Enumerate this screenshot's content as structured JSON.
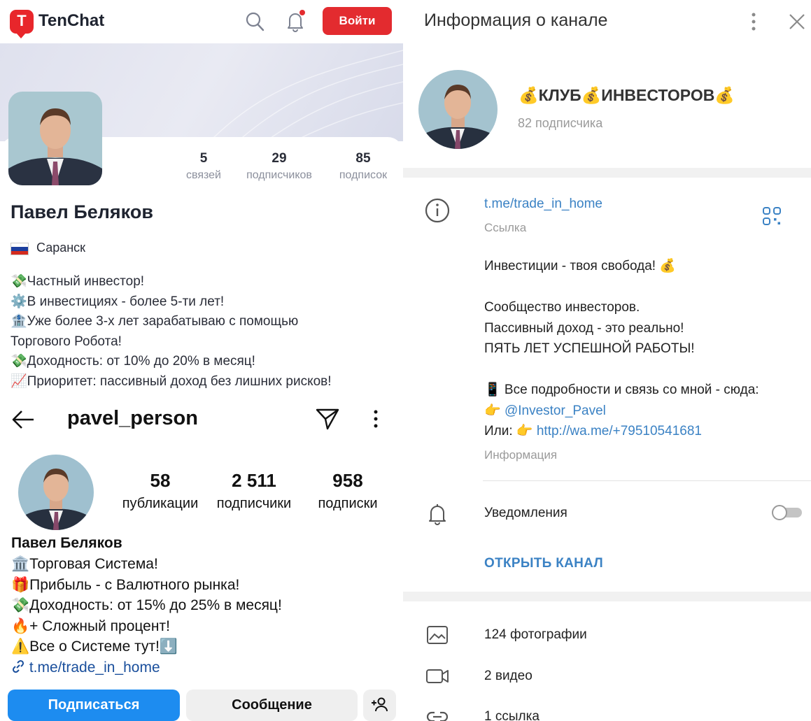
{
  "tenchat": {
    "logo_letter": "T",
    "logo_text": "TenChat",
    "login_label": "Войти",
    "stats": [
      {
        "num": "5",
        "label": "связей"
      },
      {
        "num": "29",
        "label": "подписчиков"
      },
      {
        "num": "85",
        "label": "подписок"
      }
    ],
    "name": "Павел Беляков",
    "city": "Саранск",
    "bio": [
      "💸Частный инвестор!",
      "⚙️В инвестициях - более 5-ти лет!",
      "🏦Уже более 3-х лет зарабатываю с помощью",
      "Торгового Робота!",
      "💸Доходность: от 10% до 20% в месяц!",
      "📈Приоритет: пассивный доход без лишних рисков!"
    ],
    "icons": {
      "search": "search-icon",
      "bell": "bell-icon",
      "accent": "#e32b2f"
    }
  },
  "instagram": {
    "username": "pavel_person",
    "stats": [
      {
        "num": "58",
        "label": "публикации"
      },
      {
        "num": "2 511",
        "label": "подписчики"
      },
      {
        "num": "958",
        "label": "подписки"
      }
    ],
    "name": "Павел Беляков",
    "bio": [
      "🏛️Торговая Система!",
      "🎁Прибыль - с Валютного рынка!",
      "💸Доходность: от 15% до 25% в месяц!",
      "🔥+ Сложный процент!",
      "⚠️Все о Системе тут!⬇️"
    ],
    "link": "t.me/trade_in_home",
    "follow_label": "Подписаться",
    "message_label": "Сообщение",
    "accent": "#1d8cf0"
  },
  "telegram": {
    "header_title": "Информация о канале",
    "channel_name": "💰КЛУБ💰ИНВЕСТОРОВ💰",
    "subscribers": "82 подписчика",
    "link": "t.me/trade_in_home",
    "link_caption": "Ссылка",
    "description": [
      {
        "text": "Инвестиции - твоя свобода! 💰"
      },
      {
        "text": ""
      },
      {
        "text": "Сообщество инвесторов."
      },
      {
        "text": "Пассивный доход - это реально!"
      },
      {
        "text": "ПЯТЬ ЛЕТ УСПЕШНОЙ РАБОТЫ!"
      },
      {
        "text": ""
      },
      {
        "text": "📱 Все подробности и связь со мной -  сюда:"
      }
    ],
    "contact_prefix": "👉 ",
    "contact_handle": "@Investor_Pavel",
    "alt_prefix": "Или: 👉 ",
    "alt_link": "http://wa.me/+79510541681",
    "info_caption": "Информация",
    "notifications_label": "Уведомления",
    "notifications_on": false,
    "open_channel_label": "ОТКРЫТЬ КАНАЛ",
    "media": [
      {
        "icon": "photo-icon",
        "label": "124 фотографии"
      },
      {
        "icon": "video-icon",
        "label": "2 видео"
      },
      {
        "icon": "link-icon",
        "label": "1 ссылка"
      }
    ],
    "accent": "#3b82c4"
  }
}
